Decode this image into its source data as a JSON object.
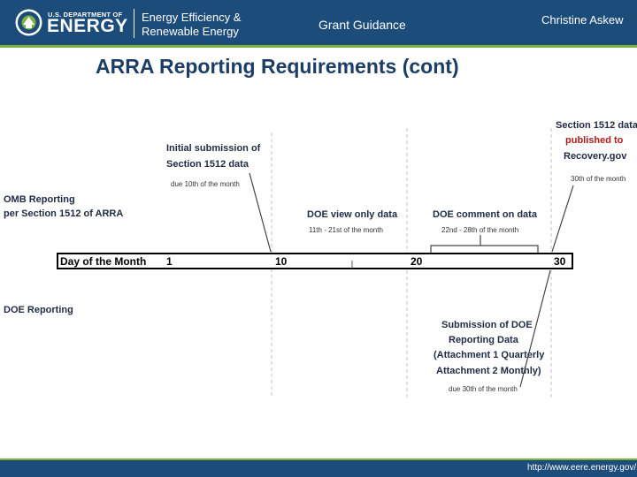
{
  "header": {
    "dept_small": "U.S. DEPARTMENT OF",
    "dept_big": "ENERGY",
    "office_line1": "Energy Efficiency &",
    "office_line2": "Renewable Energy",
    "center_title": "Grant Guidance",
    "presenter": "Christine Askew"
  },
  "title": "ARRA Reporting Requirements (cont)",
  "diagram": {
    "timeline_label": "Day of the Month",
    "days": [
      "1",
      "10",
      "20",
      "30"
    ],
    "omb_label_1": "OMB Reporting",
    "omb_label_2": "per Section 1512 of ARRA",
    "doe_label": "DOE Reporting",
    "initial_1": "Initial submission of",
    "initial_2": "Section 1512 data",
    "initial_due": "due 10th of the month",
    "doe_view": "DOE view only data",
    "doe_view_range": "11th - 21st of the month",
    "doe_comment": "DOE comment on data",
    "doe_comment_range": "22nd - 28th of the month",
    "published_1": "Section 1512 data",
    "published_2": "published to",
    "published_3": "Recovery.gov",
    "published_due": "30th of the month",
    "submission_1": "Submission of DOE",
    "submission_2": "Reporting Data",
    "submission_3": "(Attachment 1 Quarterly",
    "submission_4": "Attachment 2 Monthly)",
    "submission_due": "due 30th of the month"
  },
  "footer": {
    "url": "http://www.eere.energy.gov/"
  },
  "colors": {
    "header_bg": "#1c4c7a",
    "accent": "#7fb13f",
    "title": "#1c3d66",
    "published_text": "#b11a1a"
  }
}
